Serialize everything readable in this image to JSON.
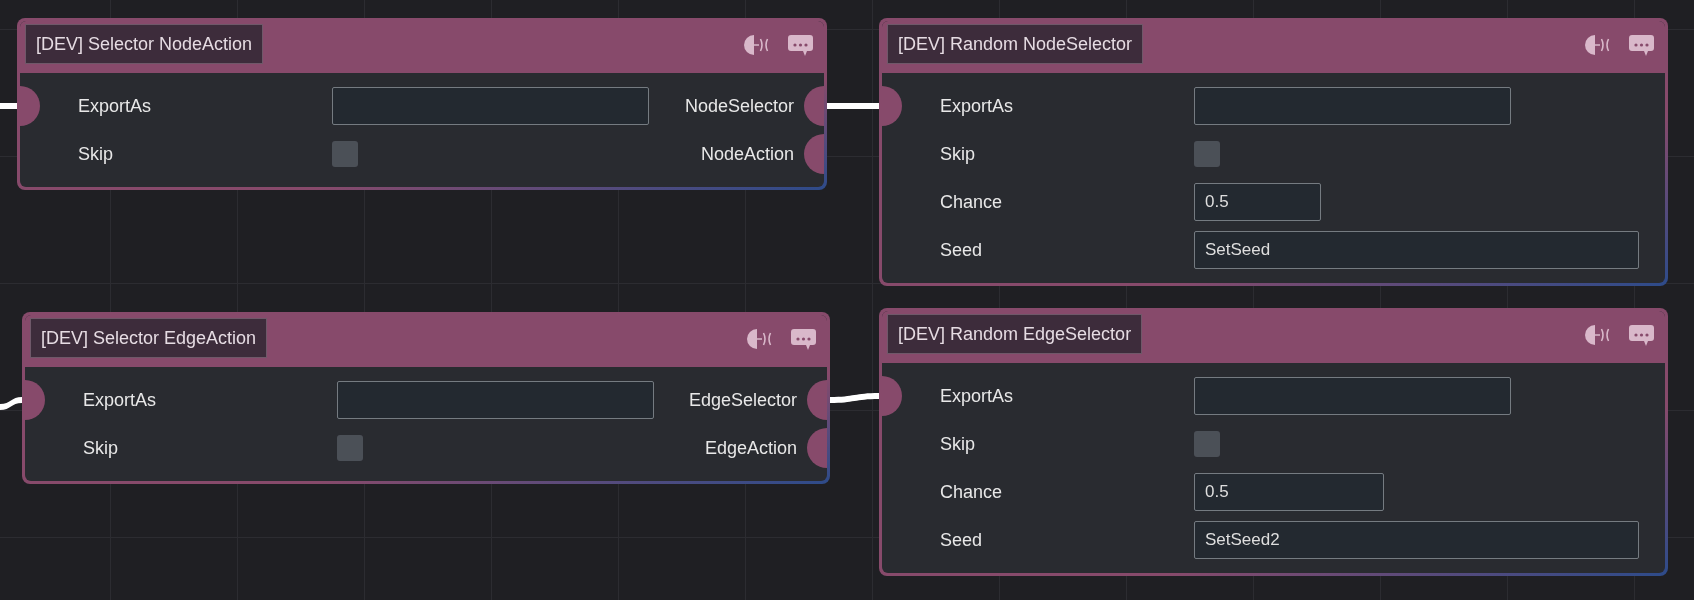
{
  "nodes": [
    {
      "title": "[DEV] Selector NodeAction",
      "input": {
        "connected": true
      },
      "fields": [
        {
          "kind": "text",
          "label": "ExportAs"
        },
        {
          "kind": "checkbox",
          "label": "Skip",
          "checked": false
        }
      ],
      "outputs": [
        {
          "label": "NodeSelector"
        },
        {
          "label": "NodeAction"
        }
      ]
    },
    {
      "title": "[DEV] Random NodeSelector",
      "input": {
        "connected": true
      },
      "fields": [
        {
          "kind": "text",
          "label": "ExportAs"
        },
        {
          "kind": "checkbox",
          "label": "Skip",
          "checked": false
        },
        {
          "kind": "number",
          "label": "Chance",
          "value": "0.5"
        },
        {
          "kind": "text",
          "label": "Seed",
          "value": "SetSeed"
        }
      ]
    },
    {
      "title": "[DEV] Selector EdgeAction",
      "input": {
        "connected": true
      },
      "fields": [
        {
          "kind": "text",
          "label": "ExportAs"
        },
        {
          "kind": "checkbox",
          "label": "Skip",
          "checked": false
        }
      ],
      "outputs": [
        {
          "label": "EdgeSelector"
        },
        {
          "label": "EdgeAction"
        }
      ]
    },
    {
      "title": "[DEV] Random EdgeSelector",
      "input": {
        "connected": true
      },
      "fields": [
        {
          "kind": "text",
          "label": "ExportAs"
        },
        {
          "kind": "checkbox",
          "label": "Skip",
          "checked": false
        },
        {
          "kind": "number",
          "label": "Chance",
          "value": "0.5"
        },
        {
          "kind": "text",
          "label": "Seed",
          "value": "SetSeed2"
        }
      ]
    }
  ]
}
